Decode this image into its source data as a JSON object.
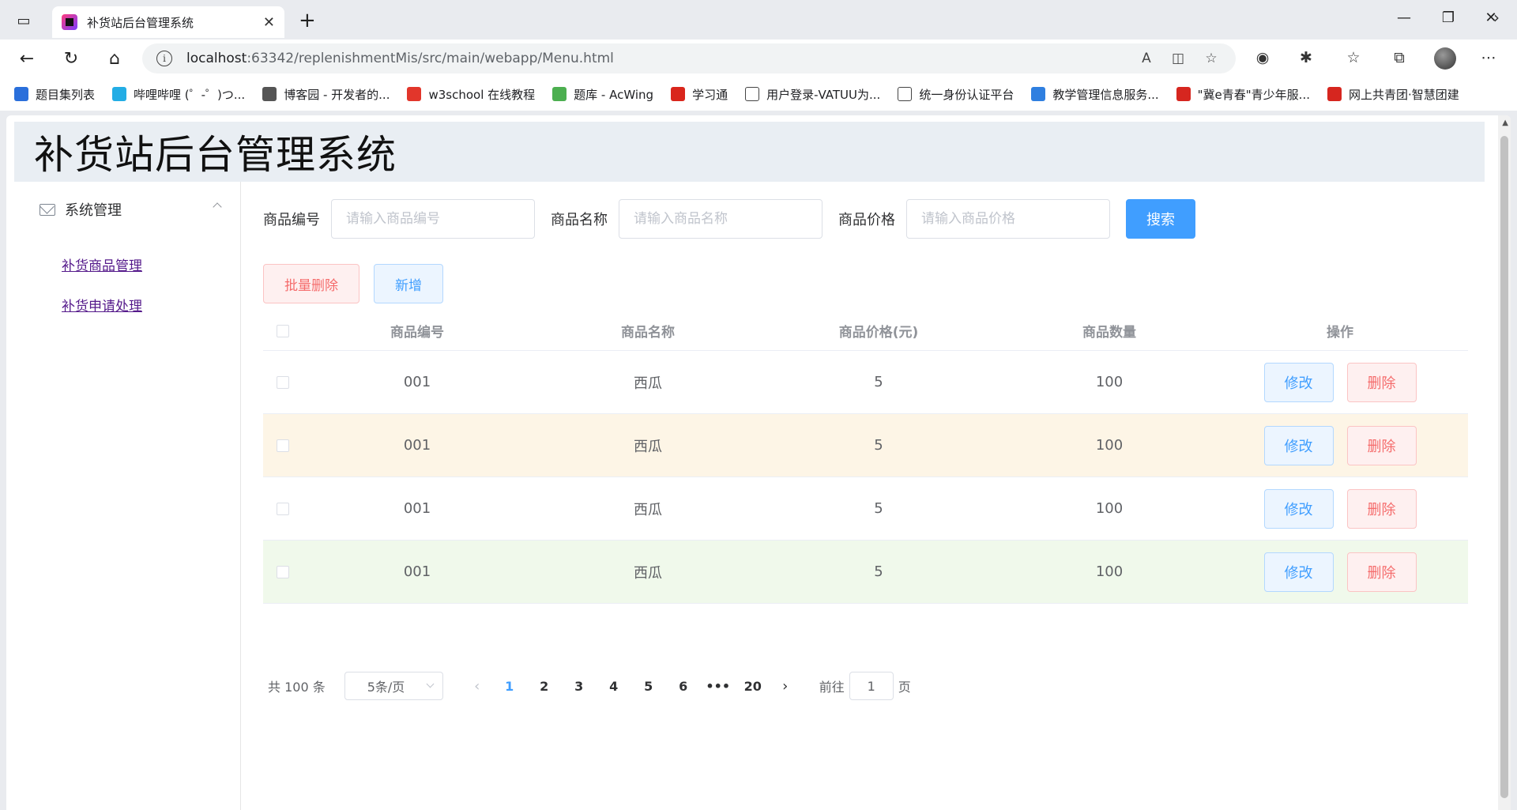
{
  "browser": {
    "tab_title": "补货站后台管理系统",
    "url_host": "localhost",
    "url_rest": ":63342/replenishmentMis/src/main/webapp/Menu.html",
    "bookmarks": [
      {
        "label": "题目集列表",
        "color": "#2a6fdb"
      },
      {
        "label": "哔哩哔哩 (゜-゜)つ...",
        "color": "#23ade5"
      },
      {
        "label": "博客园 - 开发者的...",
        "color": "#555555"
      },
      {
        "label": "w3school 在线教程",
        "color": "#e2362b"
      },
      {
        "label": "题库 - AcWing",
        "color": "#4caf50"
      },
      {
        "label": "学习通",
        "color": "#d9261c"
      },
      {
        "label": "用户登录-VATUU为...",
        "color": "#ffffff"
      },
      {
        "label": "统一身份认证平台",
        "color": "#ffffff"
      },
      {
        "label": "教学管理信息服务...",
        "color": "#2f7fe0"
      },
      {
        "label": "\"冀e青春\"青少年服...",
        "color": "#d6261f"
      },
      {
        "label": "网上共青团·智慧团建",
        "color": "#d6261f"
      }
    ]
  },
  "app": {
    "title": "补货站后台管理系统",
    "sidebar": {
      "submenu_title": "系统管理",
      "items": [
        {
          "label": "补货商品管理"
        },
        {
          "label": "补货申请处理"
        }
      ]
    },
    "search": {
      "id_label": "商品编号",
      "id_placeholder": "请输入商品编号",
      "name_label": "商品名称",
      "name_placeholder": "请输入商品名称",
      "price_label": "商品价格",
      "price_placeholder": "请输入商品价格",
      "search_button": "搜索"
    },
    "actions": {
      "batch_delete": "批量删除",
      "add": "新增"
    },
    "table": {
      "headers": [
        "商品编号",
        "商品名称",
        "商品价格(元)",
        "商品数量",
        "操作"
      ],
      "rows": [
        {
          "id": "001",
          "name": "西瓜",
          "price": "5",
          "qty": "100",
          "edit": "修改",
          "delete": "删除"
        },
        {
          "id": "001",
          "name": "西瓜",
          "price": "5",
          "qty": "100",
          "edit": "修改",
          "delete": "删除"
        },
        {
          "id": "001",
          "name": "西瓜",
          "price": "5",
          "qty": "100",
          "edit": "修改",
          "delete": "删除"
        },
        {
          "id": "001",
          "name": "西瓜",
          "price": "5",
          "qty": "100",
          "edit": "修改",
          "delete": "删除"
        }
      ]
    },
    "pagination": {
      "total": "共 100 条",
      "page_size": "5条/页",
      "pages": [
        "1",
        "2",
        "3",
        "4",
        "5",
        "6",
        "•••",
        "20"
      ],
      "current_page": "1",
      "goto_label": "前往",
      "goto_value": "1",
      "page_suffix": "页"
    }
  }
}
